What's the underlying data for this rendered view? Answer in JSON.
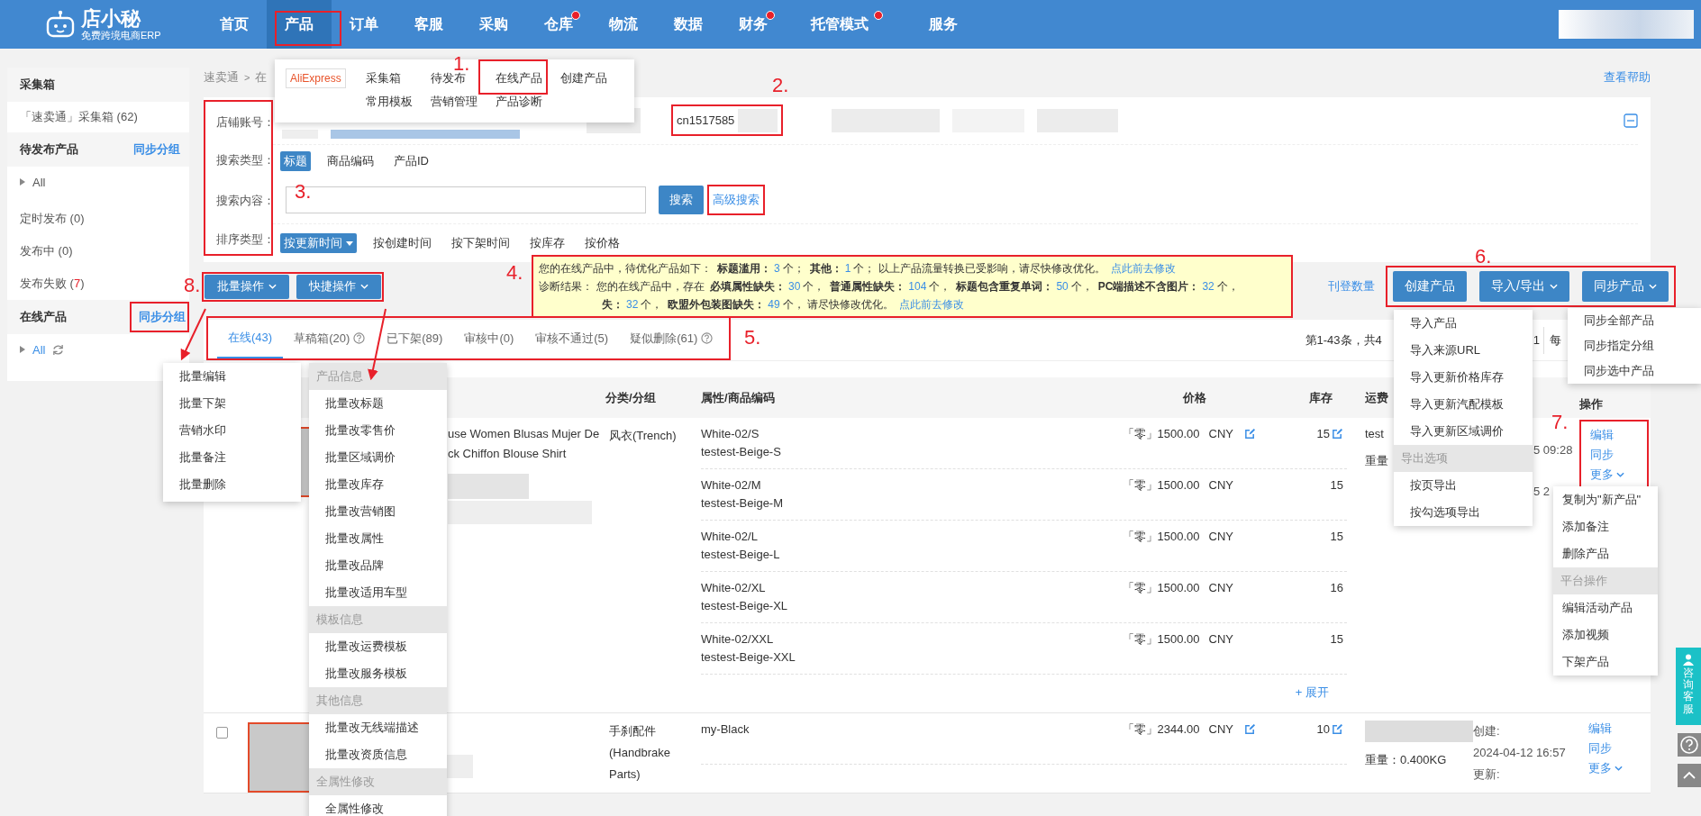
{
  "nav": {
    "logo": "店小秘",
    "logo_subtitle": "免费跨境电商ERP",
    "items": [
      {
        "label": "首页",
        "selected": false,
        "dot": false
      },
      {
        "label": "产品",
        "selected": true,
        "dot": false
      },
      {
        "label": "订单",
        "selected": false,
        "dot": false
      },
      {
        "label": "客服",
        "selected": false,
        "dot": false
      },
      {
        "label": "采购",
        "selected": false,
        "dot": false
      },
      {
        "label": "仓库",
        "selected": false,
        "dot": true
      },
      {
        "label": "物流",
        "selected": false,
        "dot": false
      },
      {
        "label": "数据",
        "selected": false,
        "dot": false
      },
      {
        "label": "财务",
        "selected": false,
        "dot": true
      },
      {
        "label": "托管模式",
        "selected": false,
        "dot": true
      },
      {
        "label": "服务",
        "selected": false,
        "dot": false
      }
    ]
  },
  "product_menu": {
    "platform": "AliExpress",
    "rows": [
      [
        "采集箱",
        "待发布",
        "在线产品",
        "创建产品"
      ],
      [
        "常用模板",
        "营销管理",
        "产品诊断"
      ]
    ]
  },
  "sidebar": {
    "sections": [
      {
        "title": "采集箱",
        "items": [
          {
            "kind": "link",
            "label": "「速卖通」采集箱 (62)"
          }
        ]
      },
      {
        "title": "待发布产品",
        "action": "同步分组",
        "items": [
          {
            "kind": "tree",
            "label": "All",
            "refresh": false
          },
          {
            "kind": "status",
            "label": "定时发布 (",
            "count": "0",
            "close": ")",
            "alert": false
          },
          {
            "kind": "status",
            "label": "发布中 (",
            "count": "0",
            "close": ")",
            "alert": false
          },
          {
            "kind": "status",
            "label": "发布失败 (",
            "count": "7",
            "close": ")",
            "alert": true
          }
        ]
      },
      {
        "title": "在线产品",
        "action": "同步分组",
        "items": [
          {
            "kind": "tree",
            "label": "All",
            "refresh": true
          }
        ]
      }
    ]
  },
  "breadcrumb": {
    "items": [
      "速卖通",
      "在"
    ],
    "separator": ">"
  },
  "help_link": "查看帮助",
  "filters": {
    "shop": {
      "label": "店铺账号：",
      "value": "cn1517585"
    },
    "search_type": {
      "label": "搜索类型：",
      "options": [
        {
          "label": "标题",
          "selected": true
        },
        {
          "label": "商品编码",
          "selected": false
        },
        {
          "label": "产品ID",
          "selected": false
        }
      ]
    },
    "search_content": {
      "label": "搜索内容：",
      "button": "搜索",
      "advanced": "高级搜索"
    },
    "sort": {
      "label": "排序类型：",
      "options": [
        {
          "label": "按更新时间",
          "selected": true
        },
        {
          "label": "按创建时间",
          "selected": false
        },
        {
          "label": "按下架时间",
          "selected": false
        },
        {
          "label": "按库存",
          "selected": false
        },
        {
          "label": "按价格",
          "selected": false
        }
      ]
    }
  },
  "batch_buttons": [
    "批量操作",
    "快捷操作"
  ],
  "notice": {
    "line1": [
      {
        "kind": "text",
        "text": "您的在线产品中，待优化产品如下："
      },
      {
        "kind": "bold",
        "text": "标题滥用："
      },
      {
        "kind": "num",
        "text": "3"
      },
      {
        "kind": "text",
        "text": "个；"
      },
      {
        "kind": "bold",
        "text": "其他："
      },
      {
        "kind": "num",
        "text": "1"
      },
      {
        "kind": "text",
        "text": "个；  以上产品流量转换已受影响，请尽快修改优化。"
      },
      {
        "kind": "link",
        "text": "点此前去修改"
      }
    ],
    "label2": "诊断结果：",
    "lines2": [
      [
        {
          "kind": "text",
          "text": "您的在线产品中，存在"
        },
        {
          "kind": "bold",
          "text": "必填属性缺失："
        },
        {
          "kind": "num",
          "text": "30"
        },
        {
          "kind": "text",
          "text": "个，"
        },
        {
          "kind": "bold",
          "text": "普通属性缺失："
        },
        {
          "kind": "num",
          "text": "104"
        },
        {
          "kind": "text",
          "text": "个，"
        },
        {
          "kind": "bold",
          "text": "标题包含重复单词："
        },
        {
          "kind": "num",
          "text": "50"
        },
        {
          "kind": "text",
          "text": "个，"
        },
        {
          "kind": "bold",
          "text": "PC端描述不含图片："
        },
        {
          "kind": "num",
          "text": "32"
        },
        {
          "kind": "text",
          "text": "个，"
        }
      ],
      [
        {
          "kind": "bold",
          "text": "失："
        },
        {
          "kind": "num",
          "text": "32"
        },
        {
          "kind": "text",
          "text": "个，"
        },
        {
          "kind": "bold",
          "text": "欧盟外包装图缺失："
        },
        {
          "kind": "num",
          "text": "49"
        },
        {
          "kind": "text",
          "text": "个，  请尽快修改优化。"
        },
        {
          "kind": "link",
          "text": "点此前去修改"
        }
      ]
    ]
  },
  "listing_count_link": "刊登数量",
  "action_buttons": [
    {
      "label": "创建产品",
      "caret": false
    },
    {
      "label": "导入/导出",
      "caret": true
    },
    {
      "label": "同步产品",
      "caret": true
    }
  ],
  "tabs": [
    {
      "label": "在线(43)",
      "selected": true,
      "help": false
    },
    {
      "label": "草稿箱(20)",
      "selected": false,
      "help": true
    },
    {
      "label": "已下架(89)",
      "selected": false,
      "help": false
    },
    {
      "label": "审核中(0)",
      "selected": false,
      "help": false
    },
    {
      "label": "审核不通过(5)",
      "selected": false,
      "help": false
    },
    {
      "label": "疑似删除(61)",
      "selected": false,
      "help": true
    }
  ],
  "pagination": {
    "summary": "第1-43条，共4",
    "page": "1",
    "per_page": "每"
  },
  "table": {
    "columns": [
      "分类/分组",
      "属性/商品编码",
      "价格",
      "库存",
      "运费",
      "操作"
    ],
    "rows": [
      {
        "title_lines": [
          "use Women Blusas Mujer De",
          "ck Chiffon Blouse Shirt"
        ],
        "category": "风衣(Trench)",
        "variants": [
          {
            "attr": "White-02/S",
            "sku": "testest-Beige-S",
            "price": "「零」1500.00",
            "currency": "CNY",
            "price_edit": true,
            "stock": "15",
            "stock_edit": true
          },
          {
            "attr": "White-02/M",
            "sku": "testest-Beige-M",
            "price": "「零」1500.00",
            "currency": "CNY",
            "price_edit": false,
            "stock": "15",
            "stock_edit": false
          },
          {
            "attr": "White-02/L",
            "sku": "testest-Beige-L",
            "price": "「零」1500.00",
            "currency": "CNY",
            "price_edit": false,
            "stock": "15",
            "stock_edit": false
          },
          {
            "attr": "White-02/XL",
            "sku": "testest-Beige-XL",
            "price": "「零」1500.00",
            "currency": "CNY",
            "price_edit": false,
            "stock": "16",
            "stock_edit": false
          },
          {
            "attr": "White-02/XXL",
            "sku": "testest-Beige-XXL",
            "price": "「零」1500.00",
            "currency": "CNY",
            "price_edit": false,
            "stock": "15",
            "stock_edit": false
          }
        ],
        "expand": "+ 展开",
        "shipping": [
          "test",
          "重量"
        ],
        "time": [
          "5 09:28",
          "5 2"
        ],
        "actions": [
          "编辑",
          "同步",
          "更多"
        ]
      },
      {
        "checked": false,
        "title_lines": [],
        "category": "手刹配件(Handbrake Parts)",
        "variants": [
          {
            "attr": "my-Black",
            "price": "「零」2344.00",
            "currency": "CNY",
            "price_edit": true,
            "stock": "10",
            "stock_edit": true
          }
        ],
        "shipping": [
          "重量：0.400KG"
        ],
        "time": [
          "创建:",
          "2024-04-12 16:57",
          "更新:"
        ],
        "actions": [
          "编辑",
          "同步",
          "更多"
        ]
      }
    ]
  },
  "batch_menu": [
    "批量编辑",
    "批量下架",
    "营销水印",
    "批量备注",
    "批量删除"
  ],
  "quick_menu": [
    {
      "kind": "header",
      "label": "产品信息"
    },
    {
      "kind": "item",
      "label": "批量改标题"
    },
    {
      "kind": "item",
      "label": "批量改零售价"
    },
    {
      "kind": "item",
      "label": "批量区域调价"
    },
    {
      "kind": "item",
      "label": "批量改库存"
    },
    {
      "kind": "item",
      "label": "批量改营销图"
    },
    {
      "kind": "item",
      "label": "批量改属性"
    },
    {
      "kind": "item",
      "label": "批量改品牌"
    },
    {
      "kind": "item",
      "label": "批量改适用车型"
    },
    {
      "kind": "header",
      "label": "模板信息"
    },
    {
      "kind": "item",
      "label": "批量改运费模板"
    },
    {
      "kind": "item",
      "label": "批量改服务模板"
    },
    {
      "kind": "header",
      "label": "其他信息"
    },
    {
      "kind": "item",
      "label": "批量改无线端描述"
    },
    {
      "kind": "item",
      "label": "批量改资质信息"
    },
    {
      "kind": "header",
      "label": "全属性修改"
    },
    {
      "kind": "item",
      "label": "全属性修改"
    }
  ],
  "import_menu": [
    {
      "kind": "item",
      "label": "导入产品"
    },
    {
      "kind": "item",
      "label": "导入来源URL"
    },
    {
      "kind": "item",
      "label": "导入更新价格库存"
    },
    {
      "kind": "item",
      "label": "导入更新汽配模板"
    },
    {
      "kind": "item",
      "label": "导入更新区域调价"
    },
    {
      "kind": "header",
      "label": "导出选项"
    },
    {
      "kind": "item",
      "label": "按页导出"
    },
    {
      "kind": "item",
      "label": "按勾选项导出"
    }
  ],
  "sync_menu": [
    {
      "kind": "item",
      "label": "同步全部产品"
    },
    {
      "kind": "item",
      "label": "同步指定分组"
    },
    {
      "kind": "item",
      "label": "同步选中产品"
    }
  ],
  "more_menu": [
    {
      "kind": "item",
      "label": "复制为\"新产品\""
    },
    {
      "kind": "item",
      "label": "添加备注"
    },
    {
      "kind": "item",
      "label": "删除产品"
    },
    {
      "kind": "header",
      "label": "平台操作"
    },
    {
      "kind": "item",
      "label": "编辑活动产品"
    },
    {
      "kind": "item",
      "label": "添加视频"
    },
    {
      "kind": "item",
      "label": "下架产品"
    }
  ],
  "support_tab": "咨询客服",
  "annotations": [
    "1.",
    "2.",
    "3.",
    "4.",
    "5.",
    "6.",
    "7.",
    "8."
  ]
}
